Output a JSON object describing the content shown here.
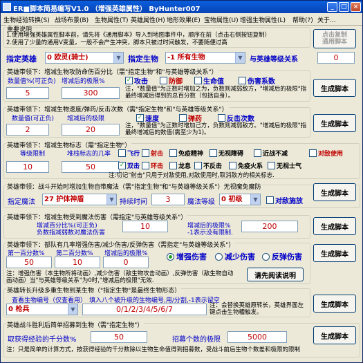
{
  "window": {
    "title": "ER■脚本简易编写V1.0 （增强英雄属性） ByHunter007",
    "min_icon": "_",
    "max_icon": "□",
    "close_icon": "×"
  },
  "menu": [
    "生物经验转换(S)",
    "战场布景(B)",
    "生物属性(T)",
    "英雄属性(H)",
    "地形效果(E)",
    "宝物属性(U)",
    "增强生物属性(L)",
    "帮助(?)",
    "关于..."
  ],
  "important": {
    "heading": "重要说明",
    "line1": "1.使用增强英雄属性脚本前，请先将《通用脚本》导入到地图事件中，顺序在前（点击右侧按钮复制）",
    "line2": "2.使用了少量的通用V变量，一般不会产生冲突，脚本只被过时间触发，不要随便过高",
    "copy_button": "点击复制\n通用脚本"
  },
  "selectors": {
    "hero_label": "指定英雄",
    "hero_value": "0 欧灵(骑士)",
    "creature_label": "指定生物",
    "creature_value": "-1 所有生物",
    "level_label": "与英雄等级关系",
    "level_value": "0"
  },
  "generate_label": "生成脚本",
  "g1": {
    "title": "英雄带领下：增减生物攻防命伤百分比（需\"指定生物\"和\"与英雄等级关系\"）",
    "col1": "数量值%(可正负)",
    "col2": "增减后的极限%",
    "v1": "5",
    "v2": "300",
    "checks": [
      "攻击",
      "防御",
      "生命值",
      "伤害系数"
    ],
    "checked": [
      true,
      false,
      false,
      false
    ],
    "note": "注，\"数量值\"为正数时增加之为，负数则减弱敌方，\"增减后的极限\"指最终增减后得到的总百分数（包括自身）。"
  },
  "g2": {
    "title": "英雄带领下：增减生物速度/弹药/反击次数（需\"指定生物\"和\"与英雄等级关系\"）",
    "col1": "数量值(可正负)",
    "col2": "增减后的极限",
    "v1": "2",
    "v2": "20",
    "checks": [
      "速度",
      "弹药",
      "反击次数"
    ],
    "checked": [
      true,
      false,
      false
    ],
    "note": "注，\"数量值\"为正数时增加己方，负数则减弱敌方。\"增减后的极限\"指最终增减后的数值(需至少为1)。"
  },
  "g3": {
    "title": "英雄带领下：增减生物标志（需\"指定生物\"）",
    "col1": "等级限制",
    "col2": "堆栈标志的几率",
    "v1": "10",
    "v2": "50",
    "row1": [
      "飞行",
      "射击",
      "免疫精神",
      "无视障碍",
      "近战不减",
      "对敌使用"
    ],
    "row1_checked": [
      false,
      false,
      false,
      false,
      false,
      false
    ],
    "row2": [
      "双击",
      "环击",
      "龙息",
      "不反击",
      "免疫火系",
      "无视士气"
    ],
    "row2_checked": [
      true,
      false,
      false,
      false,
      false,
      false
    ],
    "note": "注:切记\"射击\"只用于对敌使用,对敌使用时,取消敌方的相关标志."
  },
  "g4": {
    "title": "英雄带领：战斗开始时增加生物自带魔法（需\"指定生物\"和\"与英雄等级关系\"）无视魔免魔防",
    "spell_label": "指定魔法",
    "spell_value": "27 护体神盾",
    "duration_label": "持续时间",
    "duration_value": "3",
    "level_label": "魔法等级",
    "level_value": "0 初级",
    "check": "对敌施放",
    "checked": false
  },
  "g5": {
    "title": "英雄带领下：增减生物受到魔法伤害（需指定\"与英雄等级关系\"）",
    "col1a": "增减百分比%(可正负)",
    "col1b": "负数指减弱数对魔法伤害",
    "v1": "10",
    "col2a": "增减后的极限%",
    "col2b": "-1表示没有限制.",
    "v2": "200"
  },
  "g6": {
    "title": "英雄带领下：部队有几率增强伤害/减少伤害/反弹伤害（需指定\"与英雄等级关系\"）",
    "col1": "第一百分数%",
    "col2": "第二百分数%",
    "col3": "增减后的极限%",
    "v1": "50",
    "v2": "10",
    "v3": "0",
    "radios": [
      "增强伤害",
      "减少伤害",
      "反弹伤害"
    ],
    "selected": 0,
    "note": "注：增强伤害（本生物所将动画）,减少伤害（敌生物攻击动画）,反弹伤害（敌生物自动画动画）当\"与英雄等级关系\"为0时,\"增减后的极限\"无效.",
    "read_button": "请先阅读说明"
  },
  "g7": {
    "title": "英雄转长升级多重生物到某生物（\"指定生物\"是最终生物形态）",
    "col1": "查看生物编号（仅查看用）",
    "col2": "填入八个被升级的生物编号,用/分割,-1表示留空",
    "creature_value": "0 枪兵",
    "ids_value": "0/1/2/3/4/5/6/7",
    "note": "注：会替换英雄原转长，英雄界面左键点击生物糟触发。"
  },
  "g8": {
    "title": "英雄战斗胜利后简单招募到生物（需\"指定生物\"）",
    "label1": "取获得经验的千分数%",
    "v1": "50",
    "label2": "招募个数的极限",
    "v2": "5000",
    "note": "注：只是简单的计算方式，按获得经验的千分数除以生物生命值得到招募数，受战斗前后生物个数差和极限的限制"
  }
}
